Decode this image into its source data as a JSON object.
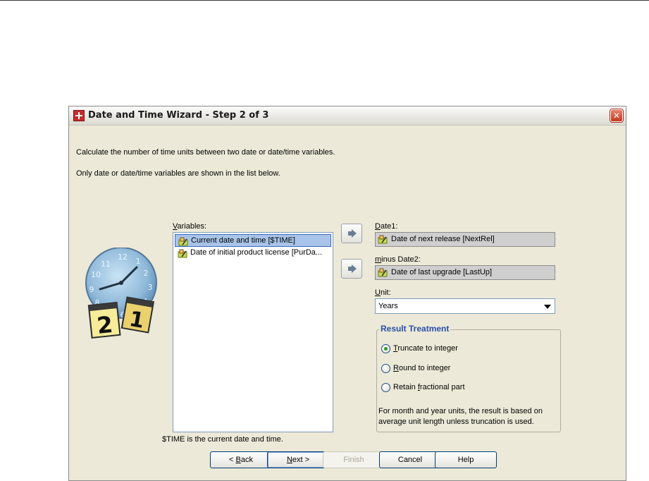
{
  "window": {
    "title": "Date and Time Wizard - Step 2 of 3",
    "close_glyph": "✕"
  },
  "description": {
    "line1": "Calculate the number of time units between two date or date/time variables.",
    "line2": "Only date or date/time variables are shown in the list below."
  },
  "illustration": {
    "day_left": "2",
    "day_right": "1"
  },
  "variables": {
    "label_pre": "",
    "label_mnemonic": "V",
    "label_post": "ariables:",
    "items": [
      {
        "label": "Current date and time [$TIME]",
        "selected": true
      },
      {
        "label": "Date of initial product license [PurDa...",
        "selected": false
      }
    ],
    "note": "$TIME is the current date and time."
  },
  "date1": {
    "label_pre": "",
    "label_mnemonic": "D",
    "label_post": "ate1:",
    "value": "Date of next release [NextRel]"
  },
  "date2": {
    "label_pre": "",
    "label_mnemonic": "m",
    "label_post": "inus Date2:",
    "value": "Date of last upgrade [LastUp]"
  },
  "unit": {
    "label_pre": "",
    "label_mnemonic": "U",
    "label_post": "nit:",
    "selected": "Years"
  },
  "result_treatment": {
    "title": "Result Treatment",
    "options": [
      {
        "pre": "",
        "mnemonic": "T",
        "post": "runcate to integer",
        "checked": true
      },
      {
        "pre": "",
        "mnemonic": "R",
        "post": "ound to integer",
        "checked": false
      },
      {
        "pre": "Retain ",
        "mnemonic": "f",
        "post": "ractional part",
        "checked": false
      }
    ],
    "note": "For month and year units, the result is based on average unit length unless truncation is used."
  },
  "buttons": {
    "back": {
      "pre": "< ",
      "mnemonic": "B",
      "post": "ack"
    },
    "next": {
      "pre": "",
      "mnemonic": "N",
      "post": "ext >"
    },
    "finish": "Finish",
    "cancel": "Cancel",
    "help": "Help"
  },
  "colors": {
    "dialog_bg": "#ece9d8",
    "selection": "#a9c4ea",
    "group_title": "#2850a8",
    "close_button": "#c2391f"
  },
  "icons": [
    "app-icon",
    "close-icon",
    "variable-icon",
    "move-arrow-icon",
    "clock-calendar-icon",
    "dropdown-arrow-icon"
  ]
}
